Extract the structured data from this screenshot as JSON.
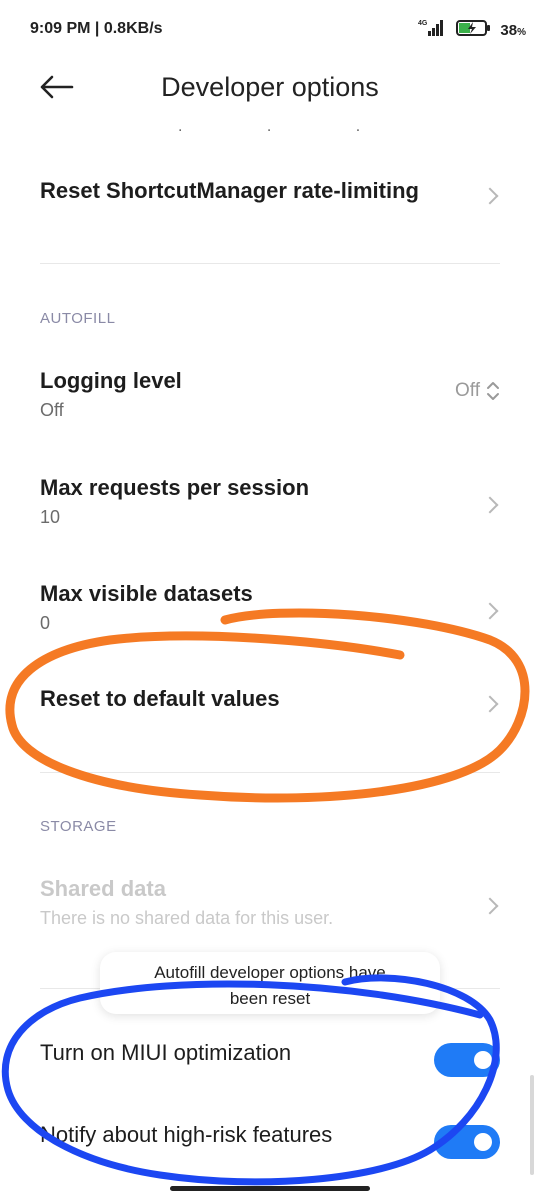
{
  "status_bar": {
    "time": "9:09 PM | 0.8KB/s",
    "network": "4G",
    "battery_percent": "38",
    "battery_suffix": "%",
    "icons": [
      "signal-icon",
      "battery-charging-icon"
    ]
  },
  "header": {
    "title": "Developer options",
    "back_icon": "back-arrow-icon",
    "truncated_text": ". . ."
  },
  "items": {
    "reset_shortcut": {
      "title": "Reset ShortcutManager rate-limiting"
    },
    "autofill_section": "AUTOFILL",
    "logging_level": {
      "title": "Logging level",
      "value": "Off",
      "selected": "Off"
    },
    "max_requests": {
      "title": "Max requests per session",
      "value": "10"
    },
    "max_visible": {
      "title": "Max visible datasets",
      "value": "0"
    },
    "reset_defaults": {
      "title": "Reset to default values"
    },
    "storage_section": "STORAGE",
    "shared_data": {
      "title": "Shared data",
      "subtitle": "There is no shared data for this user."
    },
    "miui_optimization": {
      "title": "Turn on MIUI optimization",
      "enabled": true
    },
    "high_risk": {
      "title": "Notify about high-risk features",
      "enabled": true
    }
  },
  "toast": {
    "line1": "Autofill developer options have",
    "line2": "been reset"
  },
  "colors": {
    "accent_toggle": "#1f7bf6",
    "annotation_orange": "#f57a24",
    "annotation_blue": "#1c47f2"
  }
}
